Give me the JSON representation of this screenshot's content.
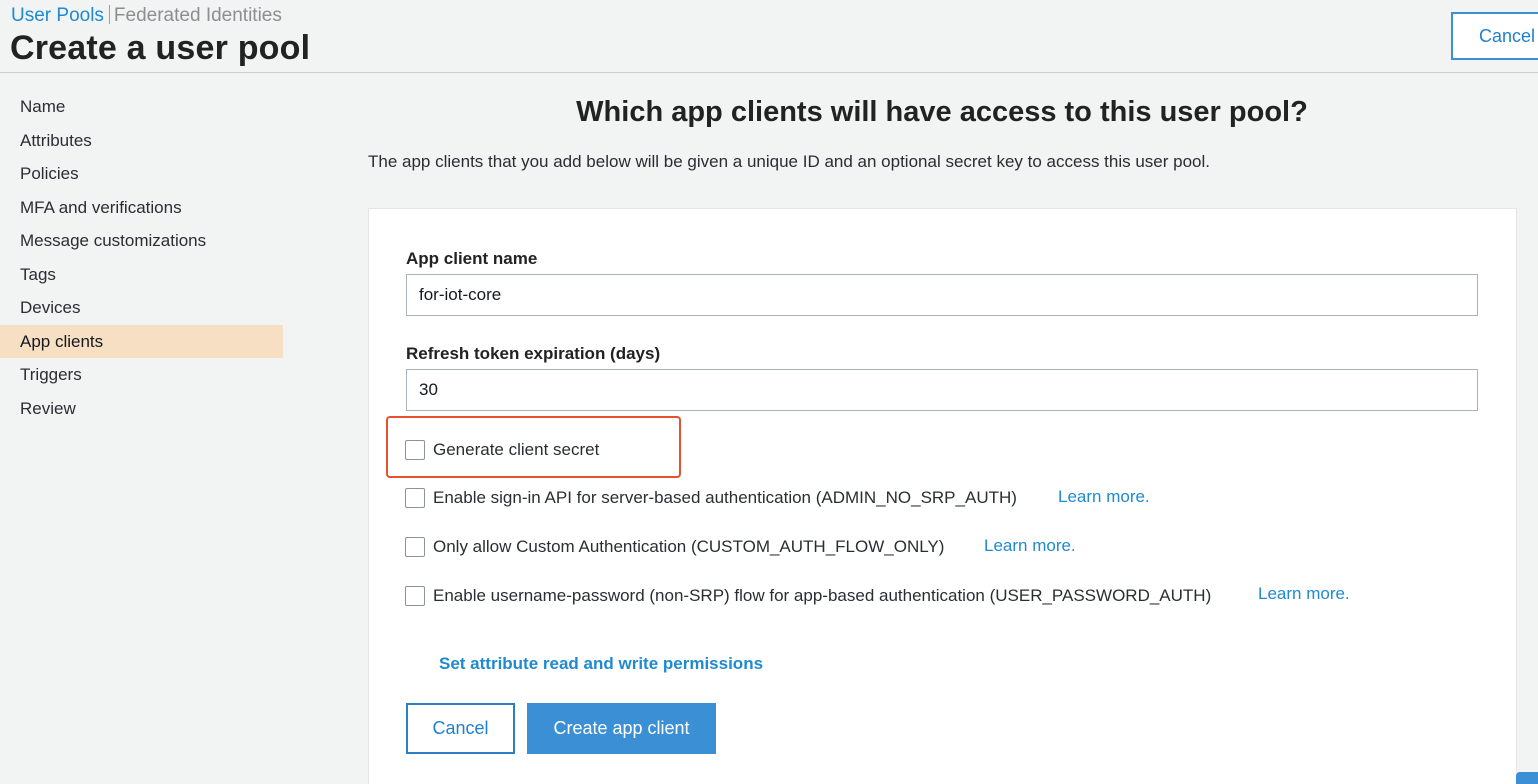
{
  "header": {
    "breadcrumb_active": "User Pools",
    "breadcrumb_other": "Federated Identities",
    "title": "Create a user pool",
    "cancel_label": "Cancel"
  },
  "sidebar": {
    "items": [
      {
        "label": "Name"
      },
      {
        "label": "Attributes"
      },
      {
        "label": "Policies"
      },
      {
        "label": "MFA and verifications"
      },
      {
        "label": "Message customizations"
      },
      {
        "label": "Tags"
      },
      {
        "label": "Devices"
      },
      {
        "label": "App clients",
        "active": true
      },
      {
        "label": "Triggers"
      },
      {
        "label": "Review"
      }
    ]
  },
  "main": {
    "title": "Which app clients will have access to this user pool?",
    "description": "The app clients that you add below will be given a unique ID and an optional secret key to access this user pool.",
    "form": {
      "app_client_name_label": "App client name",
      "app_client_name_value": "for-iot-core",
      "refresh_label": "Refresh token expiration (days)",
      "refresh_value": "30",
      "checkboxes": [
        {
          "label": "Generate client secret",
          "checked": false
        },
        {
          "label": "Enable sign-in API for server-based authentication (ADMIN_NO_SRP_AUTH)",
          "checked": false,
          "link": "Learn more."
        },
        {
          "label": "Only allow Custom Authentication (CUSTOM_AUTH_FLOW_ONLY)",
          "checked": false,
          "link": "Learn more."
        },
        {
          "label": "Enable username-password (non-SRP) flow for app-based authentication (USER_PASSWORD_AUTH)",
          "checked": false,
          "link": "Learn more."
        }
      ],
      "permissions_link": "Set attribute read and write permissions",
      "cancel_label": "Cancel",
      "create_label": "Create app client"
    }
  },
  "colors": {
    "accent": "#3a8fd5",
    "link": "#1f8ad0",
    "active_nav": "#f6dfc2",
    "highlight": "#e8512d"
  }
}
